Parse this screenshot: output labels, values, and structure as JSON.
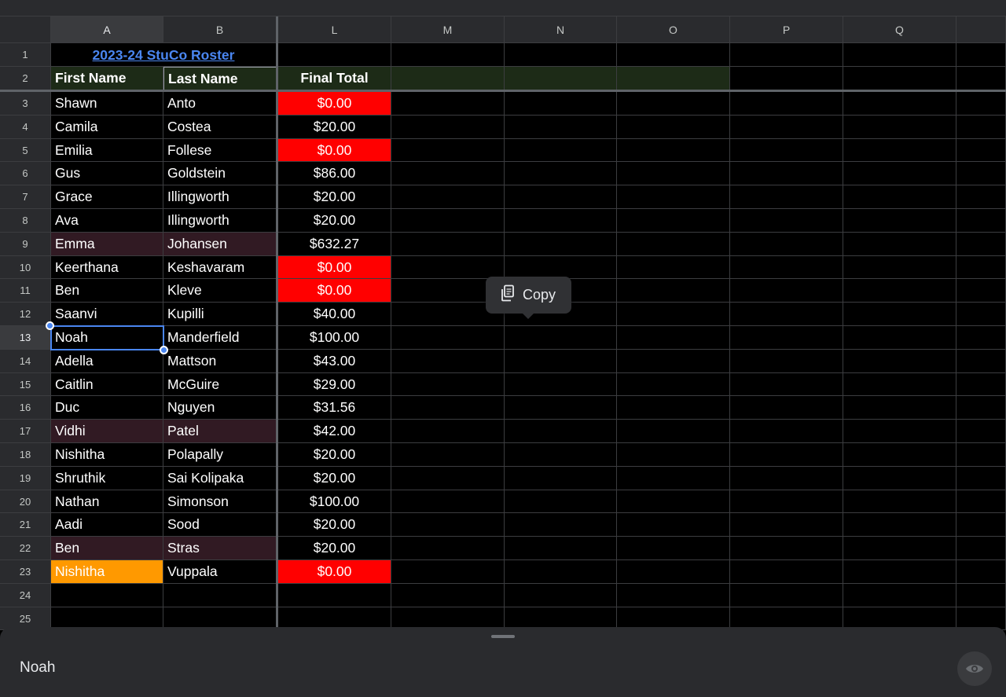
{
  "sheet": {
    "columns": [
      "A",
      "B",
      "L",
      "M",
      "N",
      "O",
      "P",
      "Q"
    ],
    "selected_column": "A",
    "selected_row": 13,
    "title": "2023-24 StuCo Roster",
    "headers": {
      "first": "First Name",
      "last": "Last Name",
      "total": "Final Total"
    },
    "rows": [
      {
        "n": 3,
        "first": "Shawn",
        "last": "Anto",
        "total": "$0.00",
        "total_style": "red"
      },
      {
        "n": 4,
        "first": "Camila",
        "last": "Costea",
        "total": "$20.00"
      },
      {
        "n": 5,
        "first": "Emilia",
        "last": "Follese",
        "total": "$0.00",
        "total_style": "red"
      },
      {
        "n": 6,
        "first": "Gus",
        "last": "Goldstein",
        "total": "$86.00"
      },
      {
        "n": 7,
        "first": "Grace",
        "last": "Illingworth",
        "total": "$20.00"
      },
      {
        "n": 8,
        "first": "Ava",
        "last": "Illingworth",
        "total": "$20.00"
      },
      {
        "n": 9,
        "first": "Emma",
        "last": "Johansen",
        "total": "$632.27",
        "name_style": "pink"
      },
      {
        "n": 10,
        "first": "Keerthana",
        "last": "Keshavaram",
        "total": "$0.00",
        "total_style": "red"
      },
      {
        "n": 11,
        "first": "Ben",
        "last": "Kleve",
        "total": "$0.00",
        "total_style": "red"
      },
      {
        "n": 12,
        "first": "Saanvi",
        "last": "Kupilli",
        "total": "$40.00"
      },
      {
        "n": 13,
        "first": "Noah",
        "last": "Manderfield",
        "total": "$100.00"
      },
      {
        "n": 14,
        "first": "Adella",
        "last": "Mattson",
        "total": "$43.00"
      },
      {
        "n": 15,
        "first": "Caitlin",
        "last": "McGuire",
        "total": "$29.00"
      },
      {
        "n": 16,
        "first": "Duc",
        "last": "Nguyen",
        "total": "$31.56"
      },
      {
        "n": 17,
        "first": "Vidhi",
        "last": "Patel",
        "total": "$42.00",
        "name_style": "pink"
      },
      {
        "n": 18,
        "first": "Nishitha",
        "last": "Polapally",
        "total": "$20.00"
      },
      {
        "n": 19,
        "first": "Shruthik",
        "last": "Sai Kolipaka",
        "total": "$20.00"
      },
      {
        "n": 20,
        "first": "Nathan",
        "last": "Simonson",
        "total": "$100.00"
      },
      {
        "n": 21,
        "first": "Aadi",
        "last": "Sood",
        "total": "$20.00"
      },
      {
        "n": 22,
        "first": "Ben",
        "last": "Stras",
        "total": "$20.00",
        "name_style": "pink"
      },
      {
        "n": 23,
        "first": "Nishitha",
        "last": "Vuppala",
        "total": "$0.00",
        "total_style": "red",
        "first_style": "orange"
      },
      {
        "n": 24,
        "first": "",
        "last": "",
        "total": ""
      },
      {
        "n": 25,
        "first": "",
        "last": "",
        "total": ""
      }
    ]
  },
  "copy_menu": {
    "label": "Copy",
    "icon": "copy-icon"
  },
  "formula_bar": {
    "value": "Noah",
    "icon": "eye-icon"
  },
  "colors": {
    "red": "#ff0000",
    "pink": "#311a23",
    "orange": "#ff9900",
    "header_green": "#1d2b17",
    "link": "#4a86f0",
    "selection": "#4a86f0"
  }
}
